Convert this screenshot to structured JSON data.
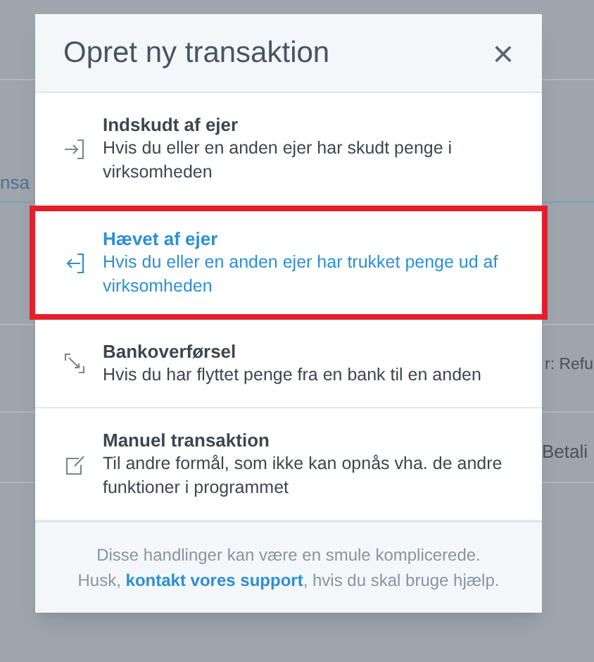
{
  "background": {
    "fragments": [
      {
        "text": "nsa",
        "kind": "link"
      },
      {
        "text": "r: Refu",
        "kind": "text"
      },
      {
        "text": "Betali",
        "kind": "text"
      }
    ]
  },
  "dialog": {
    "title": "Opret ny transaktion",
    "close": "×",
    "options": [
      {
        "kind": "deposit",
        "title": "Indskudt af ejer",
        "description": "Hvis du eller en anden ejer har skudt penge i virksomheden",
        "selected": false
      },
      {
        "kind": "withdrawal",
        "title": "Hævet af ejer",
        "description": "Hvis du eller en anden ejer har trukket penge ud af virksomheden",
        "selected": true
      },
      {
        "kind": "transfer",
        "title": "Bankoverførsel",
        "description": "Hvis du har flyttet penge fra en bank til en anden",
        "selected": false
      },
      {
        "kind": "manual",
        "title": "Manuel transaktion",
        "description": "Til andre formål, som ikke kan opnås vha. de andre funktioner i programmet",
        "selected": false
      }
    ],
    "footer": {
      "line1": "Disse handlinger kan være en smule komplicerede.",
      "before_link": "Husk,",
      "link": "kontakt vores support",
      "after_link": ", hvis du skal bruge hjælp."
    }
  }
}
